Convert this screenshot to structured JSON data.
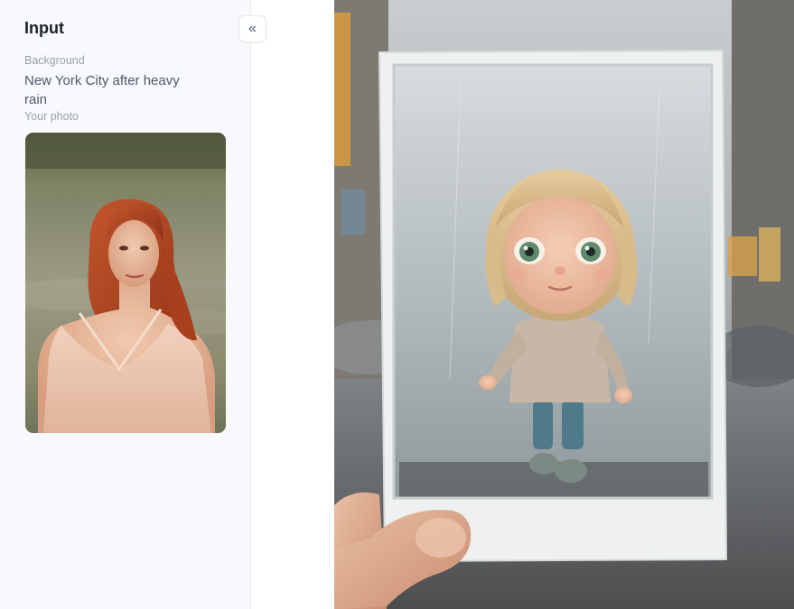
{
  "input_panel": {
    "title": "Input",
    "background_label": "Background",
    "background_value": "New York City after heavy rain",
    "photo_label": "Your photo",
    "photo_icon": "portrait-photo"
  },
  "toolbar": {
    "collapse_icon": "double-chevron-left-icon",
    "collapse_glyph": "«"
  },
  "result": {
    "icon": "generated-result-image"
  }
}
